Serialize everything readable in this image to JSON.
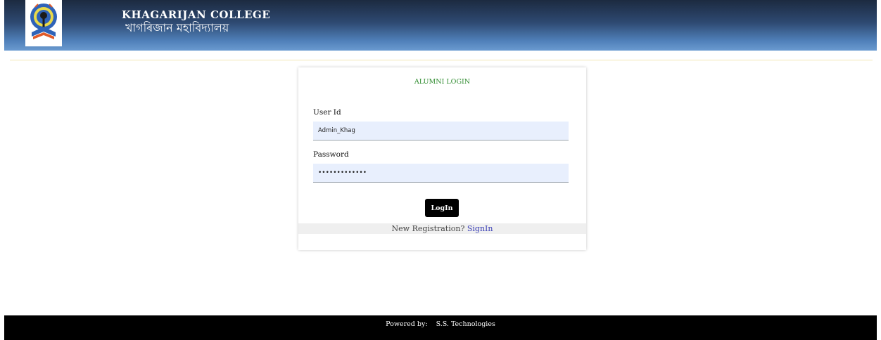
{
  "header": {
    "college_name": "KHAGARIJAN COLLEGE",
    "college_name_bn": "খাগৰিজান মহাবিদ্যালয়",
    "logo_icon": "college-emblem-icon",
    "colors": {
      "gradient_top": "#1c2a40",
      "gradient_bottom": "#6a9ad0"
    }
  },
  "login": {
    "title": "ALUMNI LOGIN",
    "user_id": {
      "label": "User Id",
      "value": "Admin_Khag"
    },
    "password": {
      "label": "Password",
      "value": "•••••••••••••"
    },
    "login_button": "LogIn",
    "register_prompt": "New Registration?",
    "signin_link": "SignIn",
    "colors": {
      "title": "#2e8b2e",
      "link": "#3a3fb5",
      "input_bg": "#e8effd"
    }
  },
  "footer": {
    "powered_by_label": "Powered by:",
    "company": "S.S. Technologies"
  }
}
